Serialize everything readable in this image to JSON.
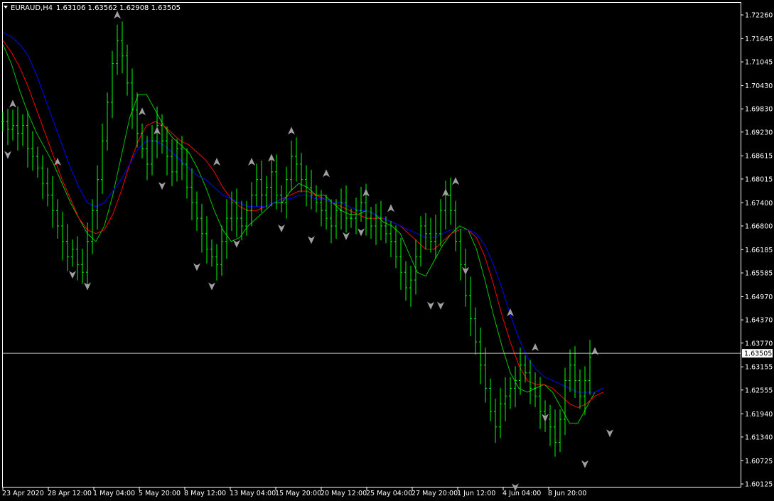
{
  "window": {
    "symbol_label": "EURAUD,H4",
    "ohlc": "1.63106 1.63562 1.62908 1.63505"
  },
  "colors": {
    "background": "#000000",
    "candles": "#00ff00",
    "fast_ma": "#00c800",
    "mid_ma": "#ff0000",
    "slow_ma": "#0000ff",
    "price_line": "#c0c0c0",
    "axis": "#ffffff",
    "fractal": "#a0a0a0"
  },
  "chart_data": {
    "type": "candlestick",
    "symbol": "EURAUD",
    "timeframe": "H4",
    "last_price": "1.63505",
    "ylim": [
      1.60125,
      1.7226
    ],
    "y_ticks": [
      "1.72260",
      "1.71645",
      "1.71045",
      "1.70430",
      "1.69830",
      "1.69230",
      "1.68615",
      "1.68015",
      "1.67400",
      "1.66800",
      "1.66185",
      "1.65585",
      "1.64970",
      "1.64370",
      "1.63770",
      "1.63155",
      "1.62555",
      "1.61940",
      "1.61340",
      "1.60725",
      "1.60125"
    ],
    "x_ticks": [
      "23 Apr 2020",
      "28 Apr 12:00",
      "1 May 04:00",
      "5 May 20:00",
      "8 May 12:00",
      "13 May 04:00",
      "15 May 20:00",
      "20 May 12:00",
      "25 May 04:00",
      "27 May 20:00",
      "1 Jun 12:00",
      "4 Jun 04:00",
      "8 Jun 20:00"
    ],
    "series": [
      {
        "name": "close",
        "values": [
          1.695,
          1.693,
          1.694,
          1.692,
          1.694,
          1.688,
          1.686,
          1.683,
          1.679,
          1.676,
          1.672,
          1.668,
          1.664,
          1.66,
          1.662,
          1.658,
          1.656,
          1.664,
          1.672,
          1.68,
          1.69,
          1.7,
          1.71,
          1.716,
          1.712,
          1.705,
          1.698,
          1.692,
          1.688,
          1.684,
          1.69,
          1.694,
          1.69,
          1.686,
          1.682,
          1.688,
          1.684,
          1.678,
          1.674,
          1.67,
          1.666,
          1.662,
          1.66,
          1.658,
          1.664,
          1.67,
          1.674,
          1.67,
          1.668,
          1.672,
          1.676,
          1.68,
          1.676,
          1.678,
          1.682,
          1.676,
          1.674,
          1.68,
          1.686,
          1.684,
          1.68,
          1.678,
          1.676,
          1.674,
          1.672,
          1.67,
          1.668,
          1.672,
          1.674,
          1.67,
          1.67,
          1.672,
          1.674,
          1.67,
          1.668,
          1.67,
          1.668,
          1.666,
          1.664,
          1.66,
          1.656,
          1.652,
          1.654,
          1.66,
          1.668,
          1.666,
          1.664,
          1.666,
          1.672,
          1.676,
          1.672,
          1.664,
          1.658,
          1.65,
          1.644,
          1.638,
          1.632,
          1.626,
          1.62,
          1.616,
          1.622,
          1.624,
          1.626,
          1.628,
          1.632,
          1.63,
          1.626,
          1.624,
          1.62,
          1.618,
          1.616,
          1.612,
          1.618,
          1.628,
          1.632,
          1.628,
          1.624,
          1.628,
          1.634
        ]
      },
      {
        "name": "fast_ma",
        "values": [
          1.715,
          1.71,
          1.703,
          1.697,
          1.692,
          1.688,
          1.684,
          1.679,
          1.674,
          1.67,
          1.666,
          1.664,
          1.668,
          1.676,
          1.686,
          1.696,
          1.702,
          1.702,
          1.698,
          1.694,
          1.691,
          1.689,
          1.687,
          1.683,
          1.678,
          1.672,
          1.667,
          1.664,
          1.665,
          1.668,
          1.67,
          1.672,
          1.674,
          1.674,
          1.677,
          1.679,
          1.678,
          1.676,
          1.676,
          1.674,
          1.672,
          1.671,
          1.671,
          1.672,
          1.671,
          1.669,
          1.668,
          1.666,
          1.661,
          1.656,
          1.655,
          1.659,
          1.663,
          1.666,
          1.668,
          1.667,
          1.662,
          1.654,
          1.645,
          1.637,
          1.63,
          1.626,
          1.625,
          1.626,
          1.627,
          1.625,
          1.621,
          1.617,
          1.617,
          1.621,
          1.625,
          1.626
        ]
      },
      {
        "name": "mid_ma",
        "values": [
          1.716,
          1.713,
          1.709,
          1.704,
          1.698,
          1.692,
          1.686,
          1.68,
          1.675,
          1.67,
          1.667,
          1.666,
          1.667,
          1.671,
          1.677,
          1.684,
          1.69,
          1.694,
          1.695,
          1.694,
          1.692,
          1.69,
          1.689,
          1.687,
          1.685,
          1.682,
          1.678,
          1.675,
          1.673,
          1.672,
          1.672,
          1.673,
          1.674,
          1.675,
          1.676,
          1.677,
          1.677,
          1.676,
          1.675,
          1.674,
          1.673,
          1.672,
          1.671,
          1.67,
          1.67,
          1.67,
          1.669,
          1.668,
          1.666,
          1.664,
          1.662,
          1.662,
          1.664,
          1.666,
          1.667,
          1.667,
          1.665,
          1.66,
          1.653,
          1.645,
          1.638,
          1.632,
          1.628,
          1.627,
          1.627,
          1.626,
          1.624,
          1.622,
          1.621,
          1.622,
          1.624,
          1.625
        ]
      },
      {
        "name": "slow_ma",
        "values": [
          1.718,
          1.717,
          1.715,
          1.712,
          1.707,
          1.701,
          1.695,
          1.689,
          1.683,
          1.678,
          1.674,
          1.673,
          1.674,
          1.677,
          1.68,
          1.684,
          1.688,
          1.69,
          1.69,
          1.689,
          1.687,
          1.685,
          1.683,
          1.681,
          1.68,
          1.678,
          1.676,
          1.675,
          1.674,
          1.673,
          1.673,
          1.673,
          1.674,
          1.675,
          1.675,
          1.676,
          1.676,
          1.675,
          1.675,
          1.674,
          1.674,
          1.673,
          1.672,
          1.672,
          1.671,
          1.67,
          1.669,
          1.668,
          1.667,
          1.666,
          1.665,
          1.665,
          1.666,
          1.667,
          1.667,
          1.667,
          1.666,
          1.663,
          1.658,
          1.652,
          1.645,
          1.639,
          1.634,
          1.631,
          1.629,
          1.628,
          1.627,
          1.626,
          1.625,
          1.625,
          1.625,
          1.626
        ]
      }
    ],
    "fractals_up": [
      [
        2,
        1.699
      ],
      [
        11,
        1.684
      ],
      [
        23,
        1.722
      ],
      [
        28,
        1.697
      ],
      [
        31,
        1.692
      ],
      [
        43,
        1.684
      ],
      [
        50,
        1.684
      ],
      [
        54,
        1.685
      ],
      [
        58,
        1.692
      ],
      [
        65,
        1.681
      ],
      [
        73,
        1.676
      ],
      [
        78,
        1.672
      ],
      [
        89,
        1.676
      ],
      [
        91,
        1.679
      ],
      [
        102,
        1.645
      ],
      [
        107,
        1.636
      ],
      [
        119,
        1.635
      ]
    ],
    "fractals_down": [
      [
        1,
        1.687
      ],
      [
        14,
        1.656
      ],
      [
        17,
        1.653
      ],
      [
        32,
        1.679
      ],
      [
        39,
        1.658
      ],
      [
        42,
        1.653
      ],
      [
        47,
        1.664
      ],
      [
        56,
        1.668
      ],
      [
        62,
        1.665
      ],
      [
        69,
        1.666
      ],
      [
        72,
        1.667
      ],
      [
        86,
        1.648
      ],
      [
        88,
        1.648
      ],
      [
        93,
        1.657
      ],
      [
        103,
        1.601
      ],
      [
        109,
        1.619
      ],
      [
        117,
        1.607
      ],
      [
        122,
        1.615
      ]
    ]
  }
}
